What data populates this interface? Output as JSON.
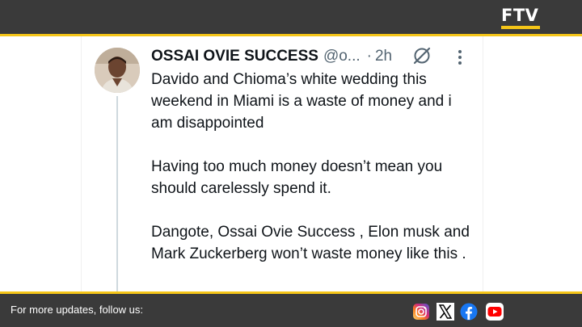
{
  "brand": {
    "logo_text": "FTV",
    "accent_color": "#f5c518",
    "background_color": "#3a3a3a"
  },
  "post": {
    "author_name": "OSSAI OVIE SUCCESS",
    "handle": "@o...",
    "separator": "·",
    "time": "2h",
    "paragraphs": [
      "Davido and Chioma’s white wedding this weekend in Miami is a waste of money and i am disappointed",
      "Having too much money doesn’t mean you should carelessly spend it.",
      "Dangote, Ossai Ovie Success , Elon musk and Mark Zuckerberg won’t waste money like this ."
    ],
    "icons": [
      "grok-icon",
      "more-options-icon"
    ]
  },
  "footer": {
    "follow_text": "For more updates, follow us:",
    "social_icons": [
      "instagram-icon",
      "x-icon",
      "facebook-icon",
      "youtube-icon"
    ]
  }
}
